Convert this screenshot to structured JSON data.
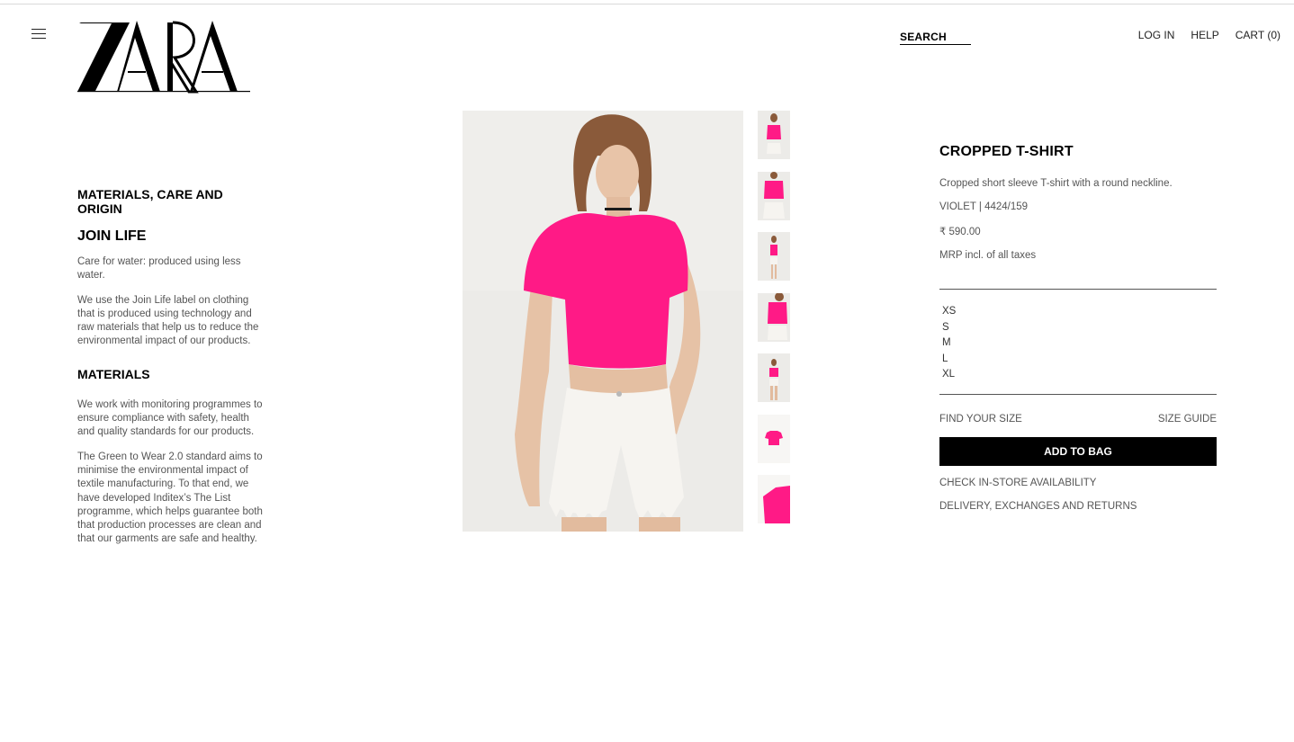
{
  "header": {
    "logo_text": "ZARA",
    "search_label": "SEARCH",
    "links": [
      "LOG IN",
      "HELP",
      "CART (0)"
    ]
  },
  "materials": {
    "section_title": "MATERIALS, CARE AND ORIGIN",
    "join_life_title": "JOIN LIFE",
    "join_life_para1": "Care for water: produced using less water.",
    "join_life_para2": "We use the Join Life label on clothing that is produced using technology and raw materials that help us to reduce the environmental impact of our products.",
    "materials_title": "MATERIALS",
    "materials_para1": "We work with monitoring programmes to ensure compliance with safety, health and quality standards for our products.",
    "materials_para2": "The Green to Wear 2.0 standard aims to minimise the environmental impact of textile manufacturing. To that end, we have developed Inditex’s The List programme, which helps guarantee both that production processes are clean and that our garments are safe and healthy."
  },
  "product": {
    "title": "CROPPED T-SHIRT",
    "description": "Cropped short sleeve T-shirt with a round neckline.",
    "color_ref": "VIOLET | 4424/159",
    "price": "₹ 590.00",
    "tax_note": "MRP incl. of all taxes",
    "sizes": [
      "XS",
      "S",
      "M",
      "L",
      "XL"
    ],
    "find_size": "FIND YOUR SIZE",
    "size_guide": "SIZE GUIDE",
    "add_to_bag": "ADD TO BAG",
    "check_store": "CHECK IN-STORE AVAILABILITY",
    "delivery": "DELIVERY, EXCHANGES AND RETURNS"
  },
  "colors": {
    "shirt": "#ff1a86",
    "shorts": "#f4f2ee",
    "photo_bg": "#ececea",
    "button": "#000000"
  },
  "icons": {
    "menu": "hamburger-menu-icon"
  }
}
